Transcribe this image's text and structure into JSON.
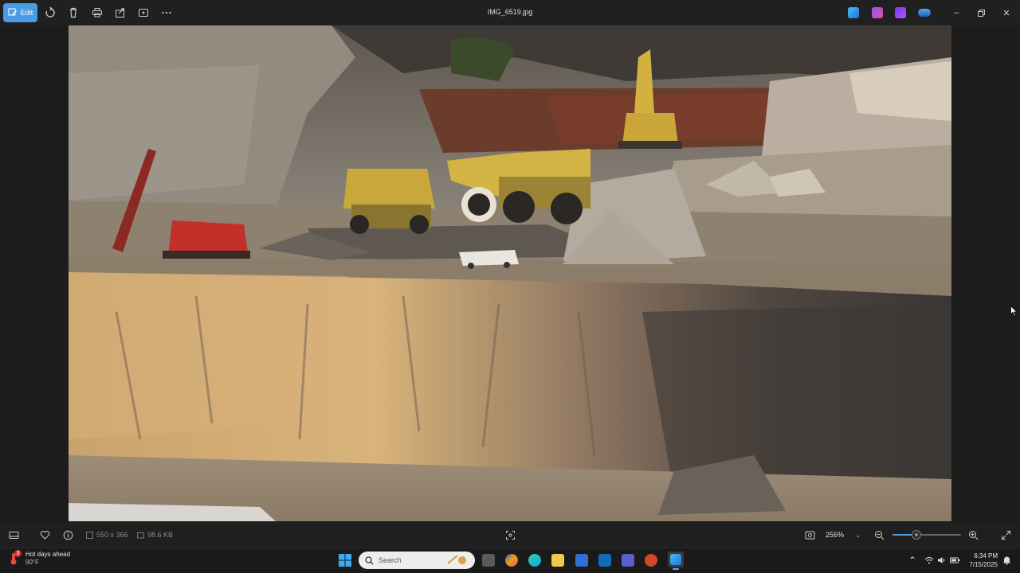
{
  "toolbar": {
    "edit_label": "Edit",
    "icons": [
      "rotate-icon",
      "delete-icon",
      "print-icon",
      "share-icon",
      "slideshow-icon",
      "more-icon"
    ]
  },
  "window": {
    "title": "IMG_6519.jpg",
    "app_icons": [
      "designer-icon",
      "clipchamp-icon",
      "copilot-icon",
      "onedrive-icon"
    ],
    "controls": [
      "minimize-icon",
      "restore-icon",
      "close-icon"
    ]
  },
  "photo": {
    "subject": "open-pit mine with haul trucks, excavator, drill rig and pickup truck"
  },
  "bottombar": {
    "dimensions": "550 x 366",
    "file_size": "98.6 KB",
    "zoom_label": "256%",
    "zoom_fraction": 0.35
  },
  "taskbar": {
    "weather_title": "Hot days ahead",
    "weather_temp": "90°F",
    "weather_badge": "3",
    "search_placeholder": "Search",
    "time": "6:34 PM",
    "date": "7/15/2025"
  },
  "colors": {
    "accent": "#4a9ce2",
    "chrome": "#202020",
    "taskbar": "#1a1a1a"
  }
}
